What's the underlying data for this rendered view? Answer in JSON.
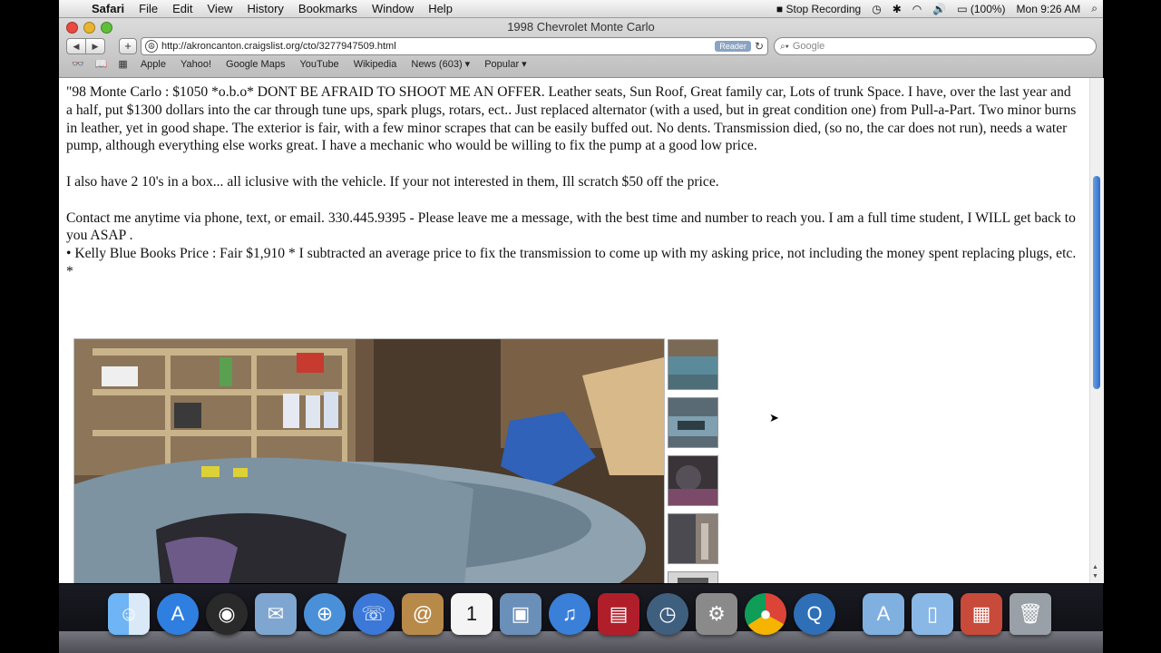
{
  "menubar": {
    "app": "Safari",
    "items": [
      "File",
      "Edit",
      "View",
      "History",
      "Bookmarks",
      "Window",
      "Help"
    ],
    "status": {
      "recording": "Stop Recording",
      "battery": "(100%)",
      "clock": "Mon 9:26 AM"
    }
  },
  "window": {
    "title": "1998 Chevrolet Monte Carlo",
    "url": "http://akroncanton.craigslist.org/cto/3277947509.html",
    "reader_label": "Reader",
    "search_placeholder": "Google"
  },
  "bookmarks": [
    "Apple",
    "Yahoo!",
    "Google Maps",
    "YouTube",
    "Wikipedia",
    "News (603) ▾",
    "Popular ▾"
  ],
  "listing": {
    "p1": "\"98 Monte Carlo : $1050 *o.b.o* DONT BE AFRAID TO SHOOT ME AN OFFER. Leather seats, Sun Roof, Great family car, Lots of trunk Space. I have, over the last year and a half, put $1300 dollars into the car through tune ups, spark plugs, rotars, ect.. Just replaced alternator (with a used, but in great condition one) from Pull-a-Part. Two minor burns in leather, yet in good shape. The exterior is fair, with a few minor scrapes that can be easily buffed out. No dents. Transmission died, (so no, the car does not run), needs a water pump, although everything else works great. I have a mechanic who would be willing to fix the pump at a good low price.",
    "p2": "I also have 2 10's in a box... all iclusive with the vehicle. If your not interested in them, Ill scratch $50 off the price.",
    "p3": "Contact me anytime via phone, text, or email. 330.445.9395 - Please leave me a message, with the best time and number to reach you. I am a full time student, I WILL get back to you ASAP .",
    "p4": "• Kelly Blue Books Price : Fair $1,910 * I subtracted an average price to fix the transmission to come up with my asking price, not including the money spent replacing plugs, etc. *"
  },
  "colors": {
    "accent": "#2d6fcf",
    "page_bg": "#ffffff"
  }
}
